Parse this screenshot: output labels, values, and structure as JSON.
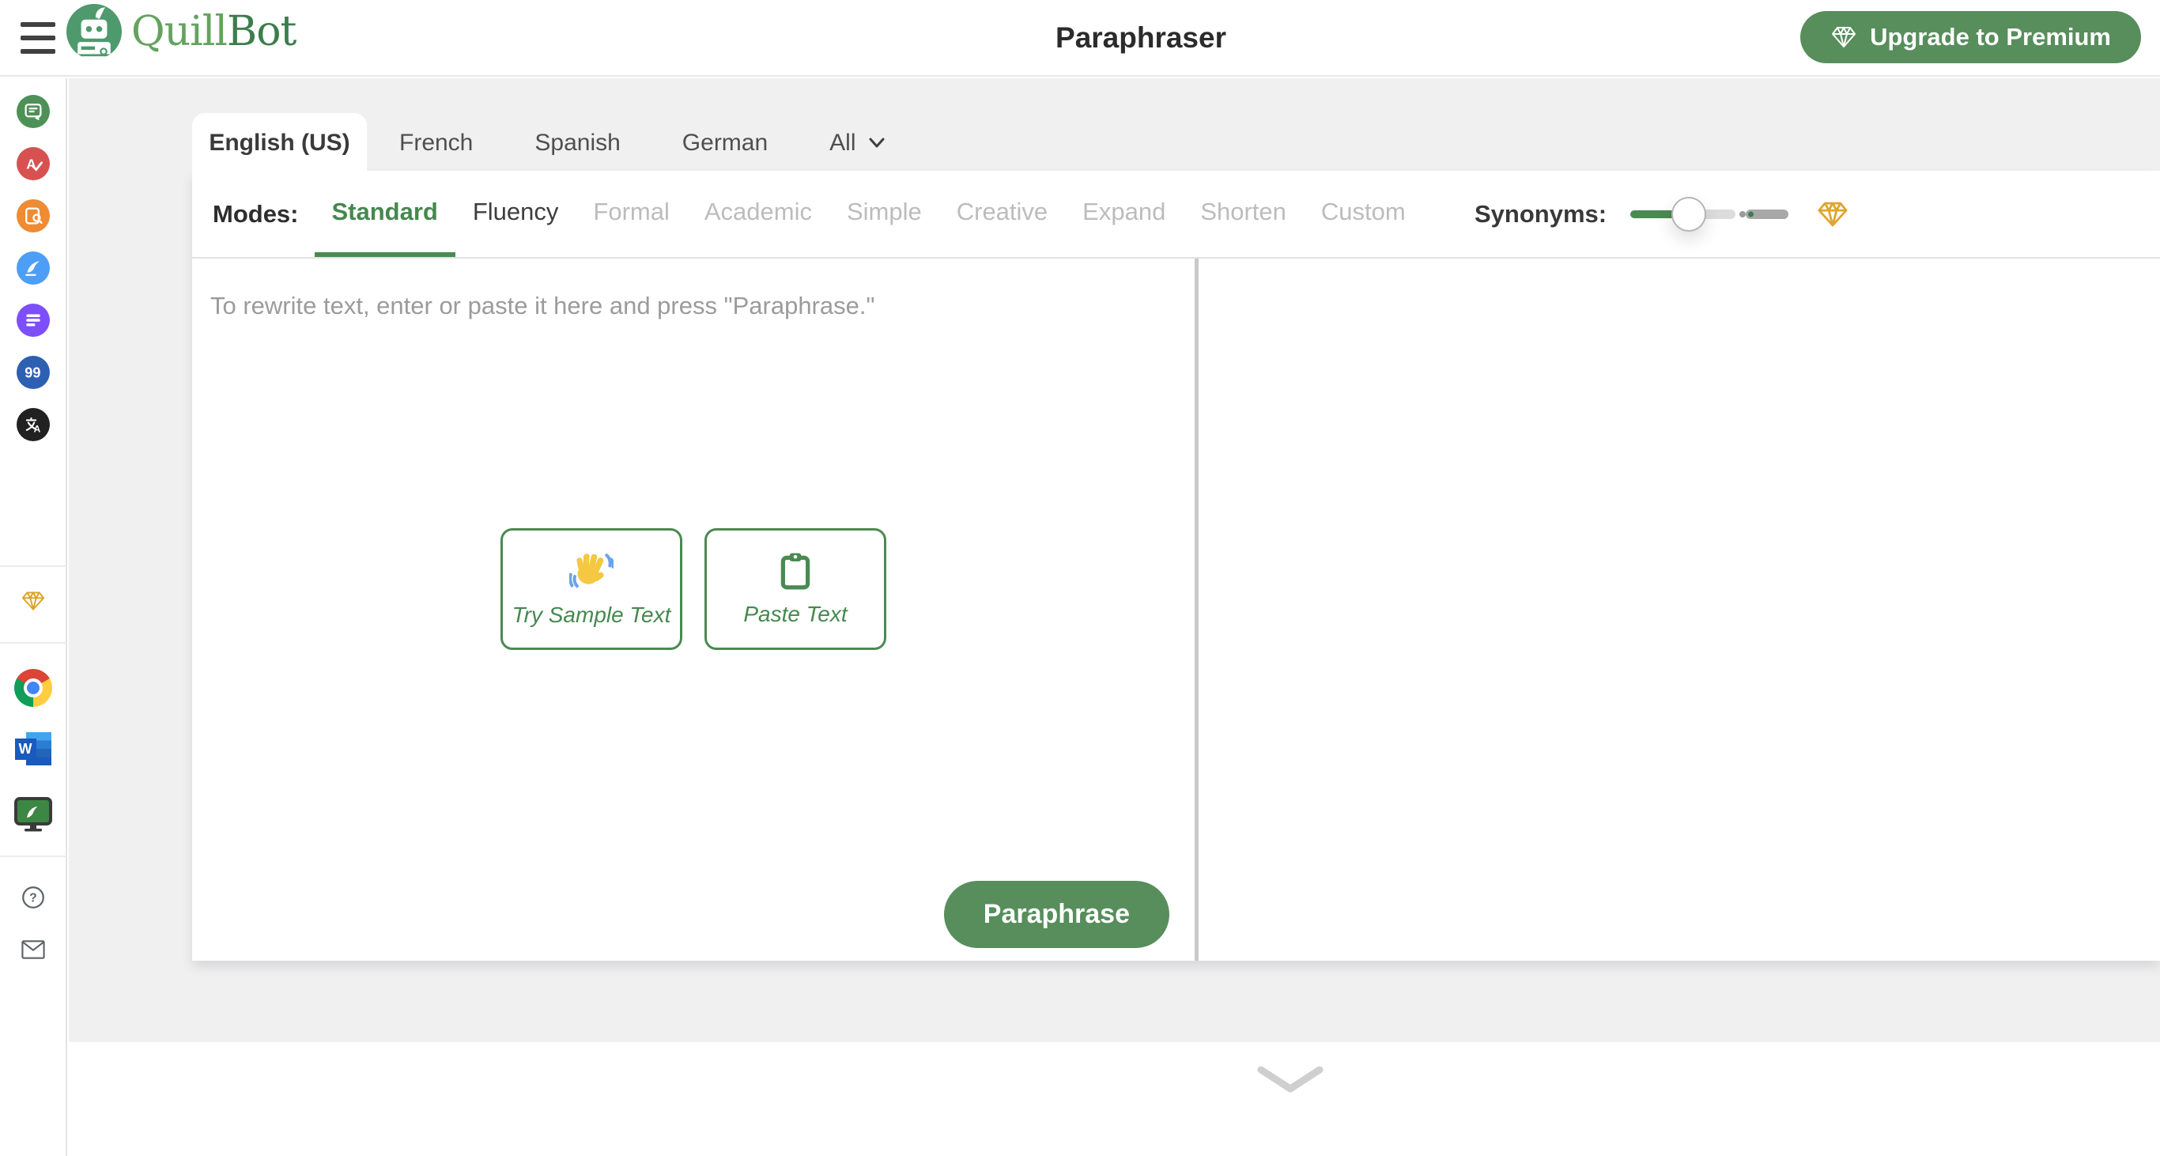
{
  "header": {
    "logo": {
      "part1": "Quill",
      "part2": "Bot"
    },
    "title": "Paraphraser",
    "upgrade_label": "Upgrade to Premium"
  },
  "tabs": {
    "active": "English (US)",
    "items": [
      {
        "label": "English (US)"
      },
      {
        "label": "French"
      },
      {
        "label": "Spanish"
      },
      {
        "label": "German"
      }
    ],
    "more_label": "All"
  },
  "modes": {
    "label": "Modes:",
    "active": "Standard",
    "items": [
      {
        "label": "Standard",
        "state": "active"
      },
      {
        "label": "Fluency",
        "state": "enabled"
      },
      {
        "label": "Formal",
        "state": "disabled"
      },
      {
        "label": "Academic",
        "state": "disabled"
      },
      {
        "label": "Simple",
        "state": "disabled"
      },
      {
        "label": "Creative",
        "state": "disabled"
      },
      {
        "label": "Expand",
        "state": "disabled"
      },
      {
        "label": "Shorten",
        "state": "disabled"
      },
      {
        "label": "Custom",
        "state": "disabled"
      }
    ]
  },
  "synonyms": {
    "label": "Synonyms:",
    "value_percent": 36,
    "premium_marker": "diamond-icon"
  },
  "editor": {
    "placeholder": "To rewrite text, enter or paste it here and press \"Paraphrase.\"",
    "sample_button": "Try Sample Text",
    "paste_button": "Paste Text",
    "paraphrase_button": "Paraphrase"
  },
  "sidebar": {
    "tools": [
      {
        "name": "paraphraser",
        "color": "#4d9156"
      },
      {
        "name": "grammar-checker",
        "color": "#d85151"
      },
      {
        "name": "plagiarism-checker",
        "color": "#ee8b33"
      },
      {
        "name": "co-writer",
        "color": "#4d9ef7"
      },
      {
        "name": "summarizer",
        "color": "#7c4ffb"
      },
      {
        "name": "citation-generator",
        "color": "#2d5fb3"
      },
      {
        "name": "translator",
        "color": "#212121"
      }
    ],
    "premium": {
      "name": "premium",
      "color": "#dba226"
    },
    "apps": [
      {
        "name": "chrome-extension"
      },
      {
        "name": "word-addin"
      },
      {
        "name": "desktop-app"
      }
    ],
    "support": [
      {
        "name": "help"
      },
      {
        "name": "contact"
      }
    ]
  },
  "colors": {
    "brand_green": "#4e9a6d",
    "button_green": "#578e5c",
    "accent_green": "#4a8a51",
    "premium_gold": "#e0a52e",
    "background_gray": "#f0f0f1",
    "disabled_text": "#bcbcbc"
  }
}
